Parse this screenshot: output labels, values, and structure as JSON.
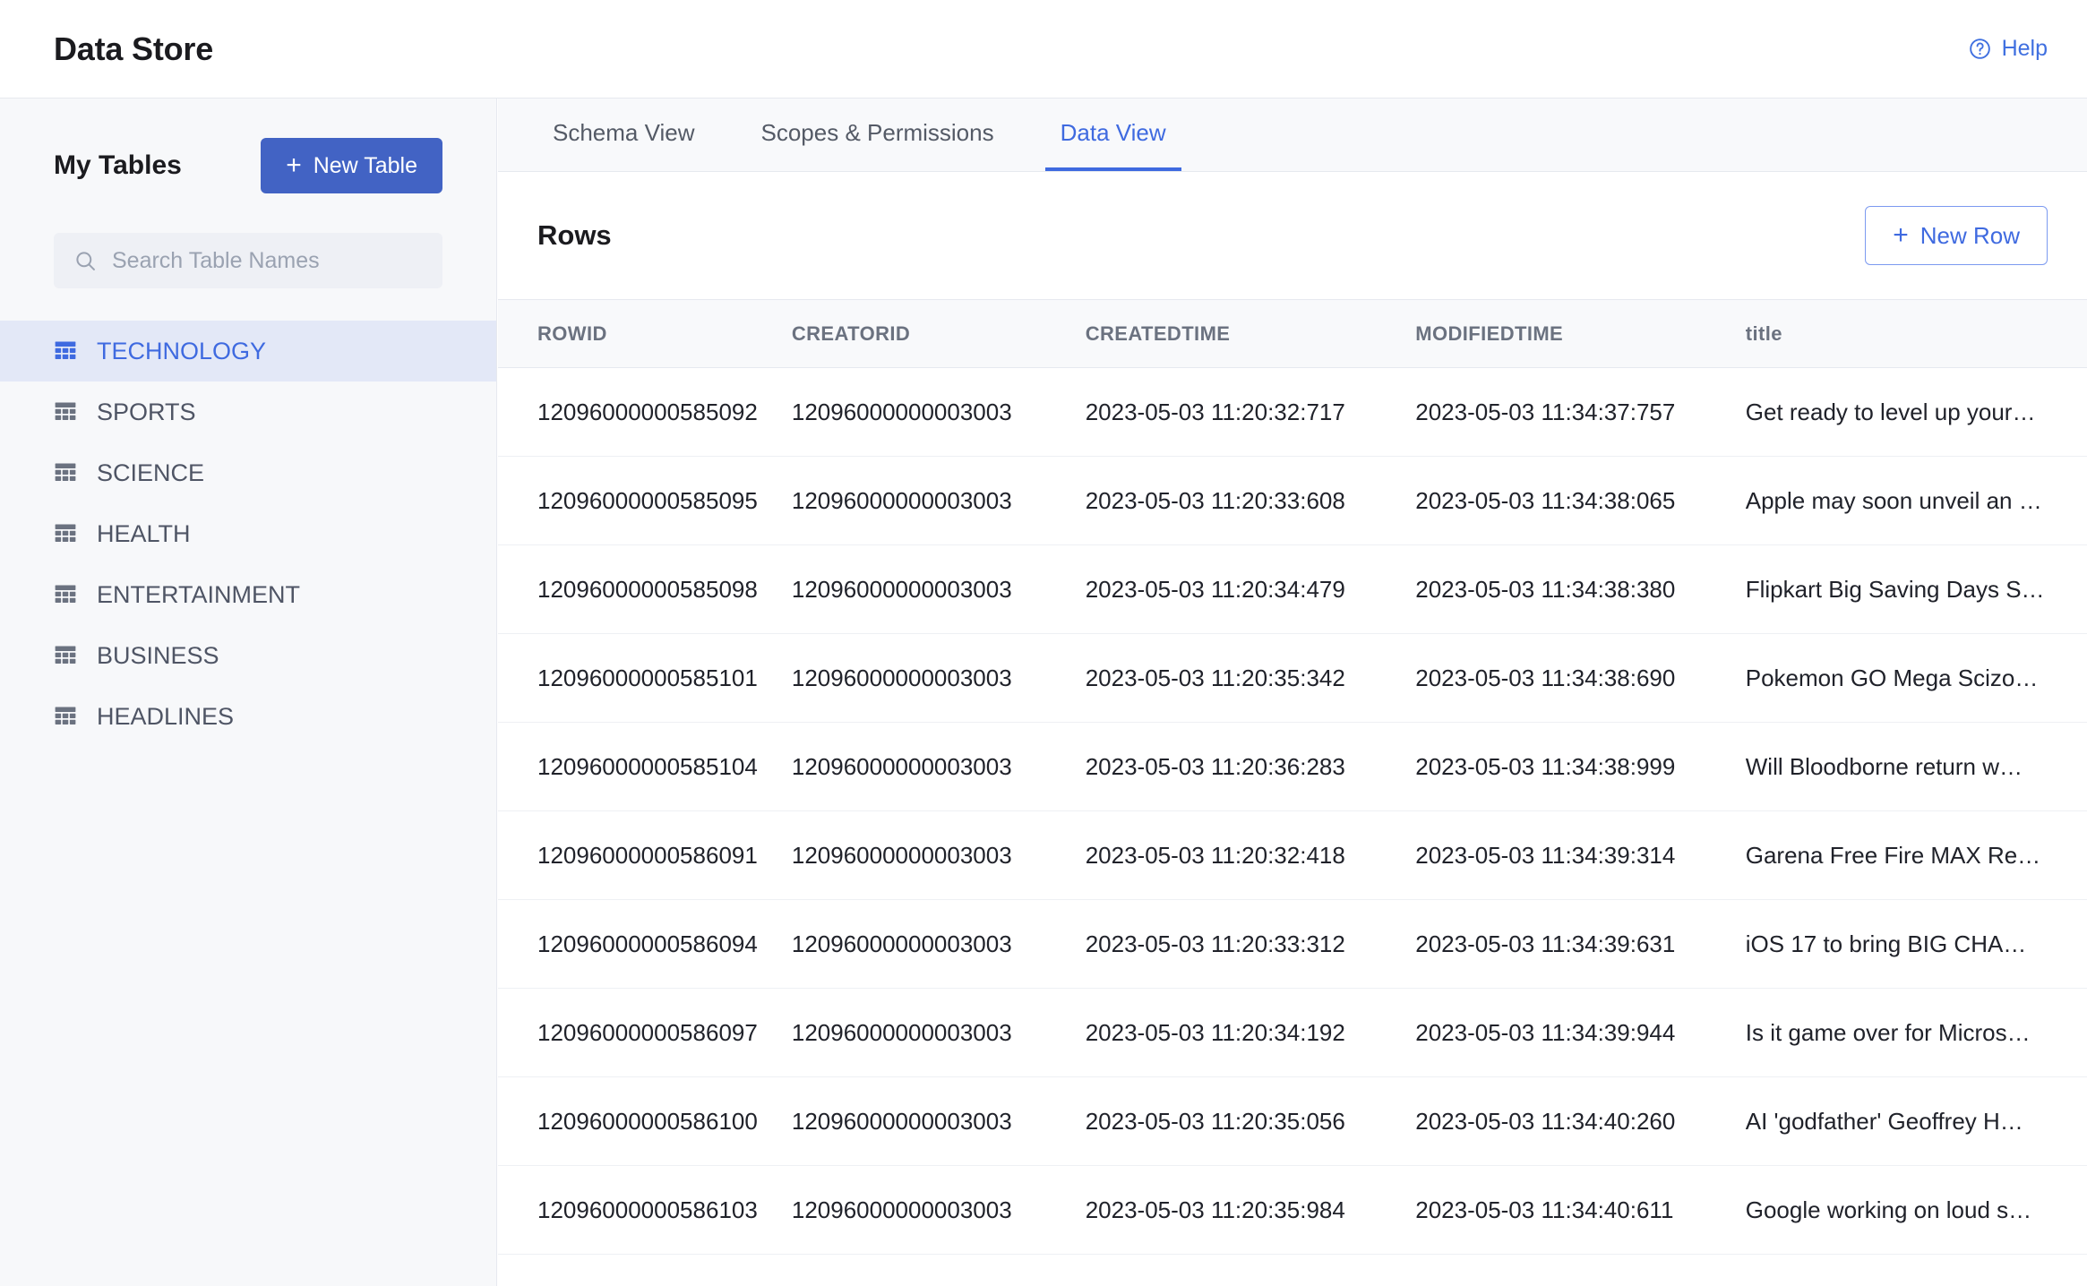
{
  "header": {
    "title": "Data Store",
    "help_label": "Help",
    "help_icon": "question-circle-icon"
  },
  "sidebar": {
    "heading": "My Tables",
    "new_table_label": "New Table",
    "new_table_plus": "+",
    "search_placeholder": "Search Table Names",
    "search_value": "",
    "search_icon": "search-icon",
    "items": [
      {
        "label": "TECHNOLOGY",
        "active": true
      },
      {
        "label": "SPORTS",
        "active": false
      },
      {
        "label": "SCIENCE",
        "active": false
      },
      {
        "label": "HEALTH",
        "active": false
      },
      {
        "label": "ENTERTAINMENT",
        "active": false
      },
      {
        "label": "BUSINESS",
        "active": false
      },
      {
        "label": "HEADLINES",
        "active": false
      }
    ]
  },
  "main": {
    "tabs": [
      {
        "label": "Schema View",
        "active": false
      },
      {
        "label": "Scopes & Permissions",
        "active": false
      },
      {
        "label": "Data View",
        "active": true
      }
    ],
    "rows_title": "Rows",
    "new_row_label": "New Row",
    "new_row_plus": "+",
    "table": {
      "columns": [
        "ROWID",
        "CREATORID",
        "CREATEDTIME",
        "MODIFIEDTIME",
        "title"
      ],
      "rows": [
        [
          "12096000000585092",
          "12096000000003003",
          "2023-05-03 11:20:32:717",
          "2023-05-03 11:34:37:757",
          "Get ready to level up your…"
        ],
        [
          "12096000000585095",
          "12096000000003003",
          "2023-05-03 11:20:33:608",
          "2023-05-03 11:34:38:065",
          "Apple may soon unveil an …"
        ],
        [
          "12096000000585098",
          "12096000000003003",
          "2023-05-03 11:20:34:479",
          "2023-05-03 11:34:38:380",
          "Flipkart Big Saving Days S…"
        ],
        [
          "12096000000585101",
          "12096000000003003",
          "2023-05-03 11:20:35:342",
          "2023-05-03 11:34:38:690",
          "Pokemon GO Mega Scizo…"
        ],
        [
          "12096000000585104",
          "12096000000003003",
          "2023-05-03 11:20:36:283",
          "2023-05-03 11:34:38:999",
          "Will Bloodborne return w…"
        ],
        [
          "12096000000586091",
          "12096000000003003",
          "2023-05-03 11:20:32:418",
          "2023-05-03 11:34:39:314",
          "Garena Free Fire MAX Re…"
        ],
        [
          "12096000000586094",
          "12096000000003003",
          "2023-05-03 11:20:33:312",
          "2023-05-03 11:34:39:631",
          "iOS 17 to bring BIG CHA…"
        ],
        [
          "12096000000586097",
          "12096000000003003",
          "2023-05-03 11:20:34:192",
          "2023-05-03 11:34:39:944",
          "Is it game over for Micros…"
        ],
        [
          "12096000000586100",
          "12096000000003003",
          "2023-05-03 11:20:35:056",
          "2023-05-03 11:34:40:260",
          "AI 'godfather' Geoffrey H…"
        ],
        [
          "12096000000586103",
          "12096000000003003",
          "2023-05-03 11:20:35:984",
          "2023-05-03 11:34:40:611",
          "Google working on loud s…"
        ]
      ]
    }
  },
  "colors": {
    "primary_button": "#4263c4",
    "link_blue": "#3f6ae0",
    "active_item_bg": "#e3e8f7",
    "sidebar_bg": "#f7f8fa",
    "tabbar_bg": "#f8f9fb"
  }
}
